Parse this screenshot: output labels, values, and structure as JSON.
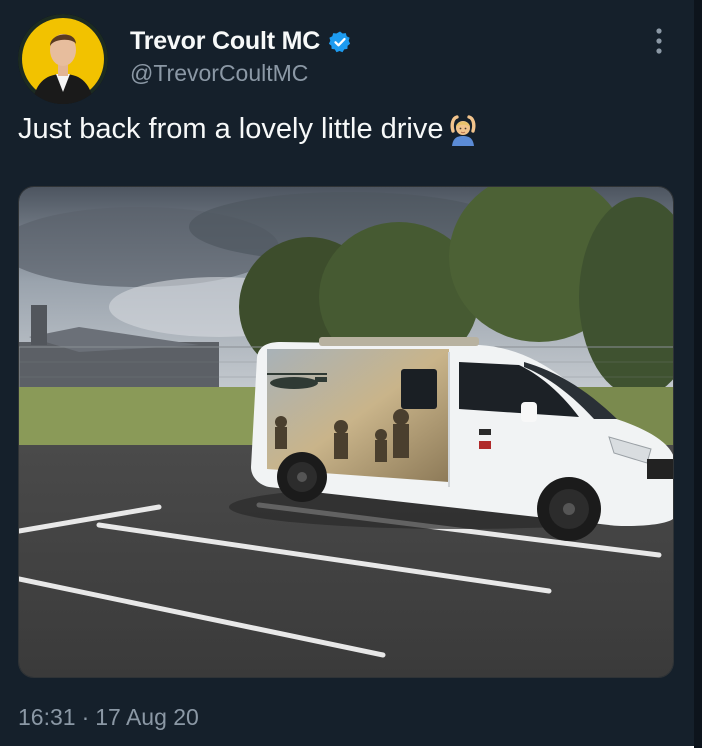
{
  "tweet": {
    "author": {
      "display_name": "Trevor Coult MC",
      "handle": "@TrevorCoultMC",
      "verified": true,
      "avatar_ring_color": "#f2c200"
    },
    "text": "Just back from a lovely little drive",
    "emoji": "🙆",
    "meta": {
      "time": "16:31",
      "separator": "·",
      "date": "17 Aug 20"
    },
    "media": {
      "kind": "photo"
    }
  },
  "icons": {
    "verified": "verified-badge-icon",
    "more": "more-vertical-icon"
  },
  "colors": {
    "background": "#15202b",
    "text_primary": "#f7f9f9",
    "text_secondary": "#8b98a5",
    "verified_blue": "#1d9bf0"
  }
}
